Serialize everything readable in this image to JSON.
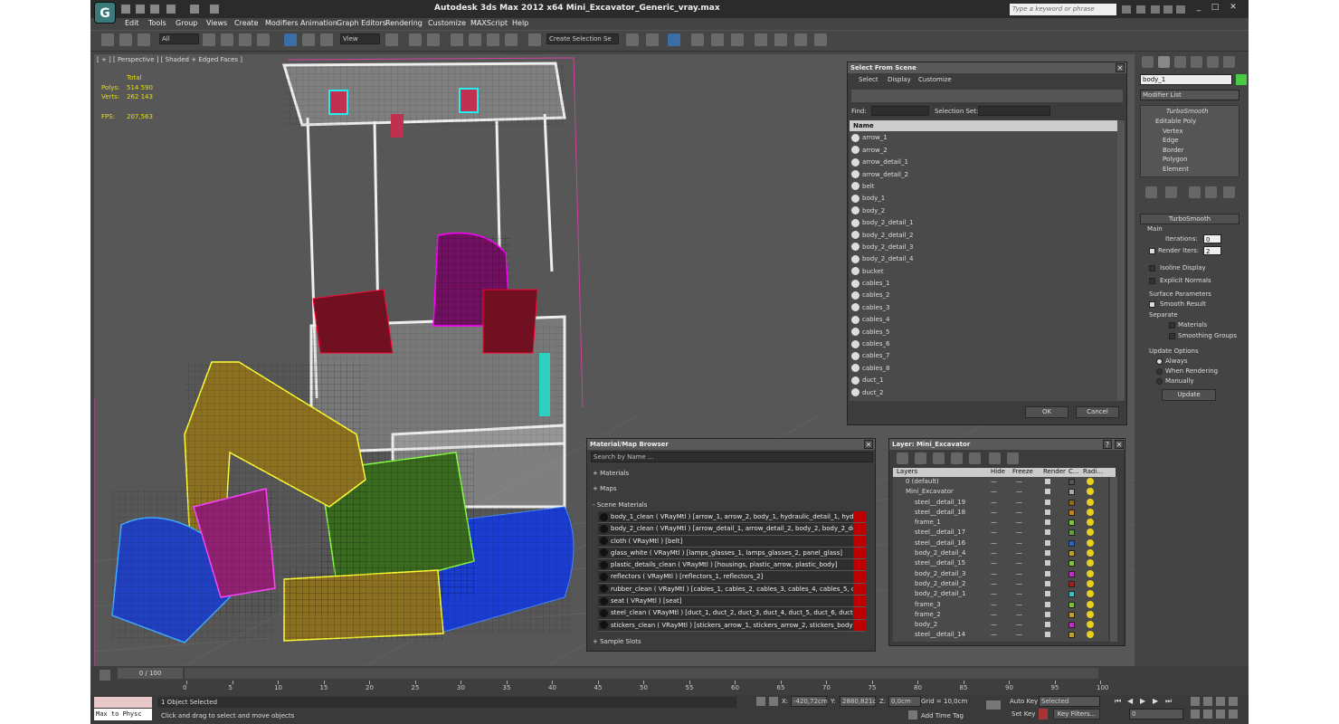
{
  "window": {
    "title": "Autodesk 3ds Max  2012 x64     Mini_Excavator_Generic_vray.max",
    "search_placeholder": "Type a keyword or phrase"
  },
  "menus": [
    "Edit",
    "Tools",
    "Group",
    "Views",
    "Create",
    "Modifiers",
    "Animation",
    "Graph Editors",
    "Rendering",
    "Customize",
    "MAXScript",
    "Help"
  ],
  "toolbar": {
    "filter": "All",
    "view": "View",
    "selection_set": "Create Selection Se"
  },
  "viewport": {
    "label": "[ + ] [ Perspective ] [ Shaded + Edged Faces ]",
    "stats_header": "Total",
    "polys_label": "Polys:",
    "polys": "514 590",
    "verts_label": "Verts:",
    "verts": "262 143",
    "fps_label": "FPS:",
    "fps": "207,563"
  },
  "command_panel": {
    "object_name": "body_1",
    "modifier_list": "Modifier List",
    "stack": [
      "TurboSmooth",
      "Editable Poly",
      "Vertex",
      "Edge",
      "Border",
      "Polygon",
      "Element"
    ],
    "rollout_title": "TurboSmooth",
    "main": "Main",
    "iterations_label": "Iterations:",
    "iterations": "0",
    "render_iters_label": "Render Iters:",
    "render_iters": "2",
    "isoline": "Isoline Display",
    "explicit": "Explicit Normals",
    "surface": "Surface Parameters",
    "smooth_result": "Smooth Result",
    "separate": "Separate",
    "materials": "Materials",
    "smoothing_groups": "Smoothing Groups",
    "update_options": "Update Options",
    "always": "Always",
    "when_rendering": "When Rendering",
    "manually": "Manually",
    "update_btn": "Update"
  },
  "select_dialog": {
    "title": "Select From Scene",
    "menus": [
      "Select",
      "Display",
      "Customize"
    ],
    "find_label": "Find:",
    "selection_set_label": "Selection Set:",
    "column": "Name",
    "items": [
      "arrow_1",
      "arrow_2",
      "arrow_detail_1",
      "arrow_detail_2",
      "belt",
      "body_1",
      "body_2",
      "body_2_detail_1",
      "body_2_detail_2",
      "body_2_detail_3",
      "body_2_detail_4",
      "bucket",
      "cables_1",
      "cables_2",
      "cables_3",
      "cables_4",
      "cables_5",
      "cables_6",
      "cables_7",
      "cables_8",
      "duct_1",
      "duct_2"
    ],
    "ok": "OK",
    "cancel": "Cancel"
  },
  "material_browser": {
    "title": "Material/Map Browser",
    "search_placeholder": "Search by Name ...",
    "sections": [
      "+ Materials",
      "+ Maps",
      "- Scene Materials"
    ],
    "materials": [
      "body_1_clean  ( VRayMtl ) [arrow_1, arrow_2, body_1, hydraulic_detail_1, hydr...",
      "body_2_clean  ( VRayMtl ) [arrow_detail_1, arrow_detail_2, body_2, body_2_de...",
      "cloth  ( VRayMtl ) [belt]",
      "glass_white  ( VRayMtl ) [lamps_glasses_1, lamps_glasses_2, panel_glass]",
      "plastic_details_clean  ( VRayMtl ) [housings, plastic_arrow, plastic_body]",
      "reflectors  ( VRayMtl ) [reflectors_1, reflectors_2]",
      "rubber_clean  ( VRayMtl ) [cables_1, cables_2, cables_3, cables_4, cables_5, ca...",
      "seat  ( VRayMtl ) [seat]",
      "steel_clean  ( VRayMtl ) [duct_1, duct_2, duct_3, duct_4, duct_5, duct_6, duct_...",
      "stickers_clean  ( VRayMtl ) [stickers_arrow_1, stickers_arrow_2, stickers_body, s..."
    ],
    "sample_slots": "+ Sample Slots"
  },
  "layer_dialog": {
    "title": "Layer: Mini_Excavator",
    "columns": [
      "Layers",
      "Hide",
      "Freeze",
      "Render",
      "C...",
      "Radi..."
    ],
    "rows": [
      {
        "name": "0 (default)",
        "color": "#555555"
      },
      {
        "name": "Mini_Excavator",
        "color": "#aaaaaa"
      },
      {
        "name": "steel__detail_19",
        "color": "#8a6a20"
      },
      {
        "name": "steel__detail_18",
        "color": "#c08020"
      },
      {
        "name": "frame_1",
        "color": "#80c040"
      },
      {
        "name": "steel__detail_17",
        "color": "#60a040"
      },
      {
        "name": "steel__detail_16",
        "color": "#3060c0"
      },
      {
        "name": "body_2_detail_4",
        "color": "#c0a030"
      },
      {
        "name": "steel__detail_15",
        "color": "#80c040"
      },
      {
        "name": "body_2_detail_3",
        "color": "#c030c0"
      },
      {
        "name": "body_2_detail_2",
        "color": "#a02020"
      },
      {
        "name": "body_2_detail_1",
        "color": "#40c0c0"
      },
      {
        "name": "frame_3",
        "color": "#80c040"
      },
      {
        "name": "frame_2",
        "color": "#c0a030"
      },
      {
        "name": "body_2",
        "color": "#c030c0"
      },
      {
        "name": "steel__detail_14",
        "color": "#c0a030"
      }
    ]
  },
  "timeline": {
    "frame": "0 / 100",
    "ticks": [
      "0",
      "5",
      "10",
      "15",
      "20",
      "25",
      "30",
      "35",
      "40",
      "45",
      "50",
      "55",
      "60",
      "65",
      "70",
      "75",
      "80",
      "85",
      "90",
      "95",
      "100"
    ]
  },
  "status": {
    "maxscript": "Max to Physc",
    "selected": "1 Object Selected",
    "prompt": "Click and drag to select and move objects",
    "x_label": "X:",
    "x": "-420,72cm",
    "y_label": "Y:",
    "y": "2880,821c",
    "z_label": "Z:",
    "z": "0,0cm",
    "grid": "Grid = 10,0cm",
    "add_time_tag": "Add Time Tag",
    "auto_key": "Auto Key",
    "set_key": "Set Key",
    "selected_dd": "Selected",
    "key_filters": "Key Filters...",
    "frame_field": "0"
  },
  "colors": {
    "bg": "#444444",
    "viewport": "#575757",
    "accent_blue": "#3a6ea5"
  }
}
